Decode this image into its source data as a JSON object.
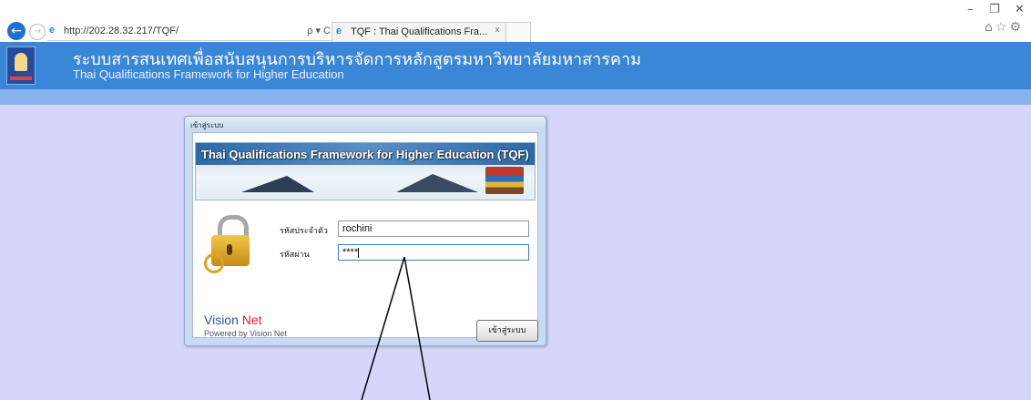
{
  "browser": {
    "url": "http://202.28.32.217/TQF/",
    "address_tools": "ρ ▾ C",
    "tab_title": "TQF : Thai Qualifications Fra...",
    "tab_close": "×",
    "back_icon": "back-arrow-icon",
    "forward_icon": "forward-arrow-icon",
    "window_controls": {
      "minimize": "–",
      "restore": "❐",
      "close": "✕"
    },
    "toolbar_icons": "⌂☆⚙"
  },
  "header": {
    "title_th": "ระบบสารสนเทศเพื่อสนับสนุนการบริหารจัดการหลักสูตรมหาวิทยาลัยมหาสารคาม",
    "subtitle_en": "Thai Qualifications Framework for Higher Education",
    "bg_color": "#3a87d8"
  },
  "login_window": {
    "title": "เข้าสู่ระบบ",
    "banner_text": "Thai Qualifications Framework for Higher Education (TQF)",
    "username_label": "รหัสประจำตัว",
    "username_value": "rochini",
    "password_label": "รหัสผ่าน",
    "password_value": "****",
    "vision_logo_a": "Vision ",
    "vision_logo_b": "Net",
    "powered_by": "Powered by Vision Net",
    "login_button": "เข้าสู่ระบบ"
  },
  "colors": {
    "content_bg": "#d6d6fa",
    "subbar": "#86b3ee"
  }
}
